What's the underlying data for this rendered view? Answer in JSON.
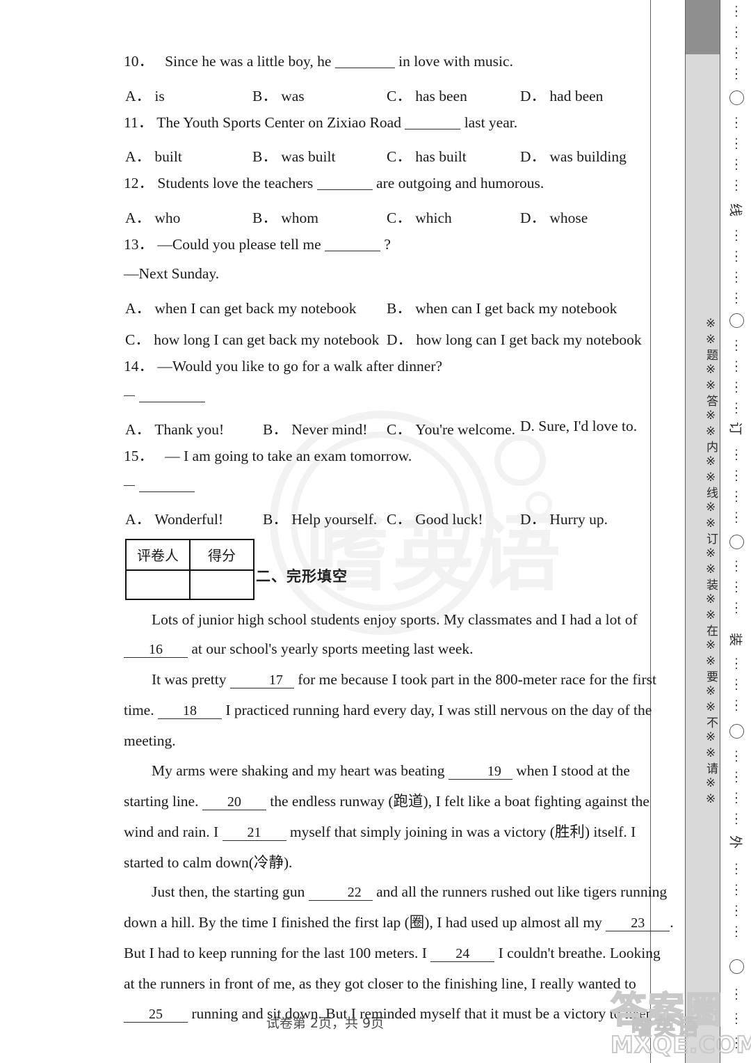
{
  "document": {
    "footer": "试卷第 2页，共 9页"
  },
  "questions": [
    {
      "number": "10．",
      "stem_before": "Since he was a little boy, he",
      "stem_after": "in love with music.",
      "options": [
        {
          "label": "A．",
          "text": "is"
        },
        {
          "label": "B．",
          "text": "was"
        },
        {
          "label": "C．",
          "text": "has been"
        },
        {
          "label": "D．",
          "text": "had been"
        }
      ]
    },
    {
      "number": "11．",
      "stem_before": "The Youth Sports Center on Zixiao Road",
      "stem_after": "last year.",
      "options": [
        {
          "label": "A．",
          "text": "built"
        },
        {
          "label": "B．",
          "text": "was built"
        },
        {
          "label": "C．",
          "text": "has built"
        },
        {
          "label": "D．",
          "text": "was building"
        }
      ]
    },
    {
      "number": "12．",
      "stem_before": "Students love the teachers",
      "stem_after": "are outgoing and humorous.",
      "options": [
        {
          "label": "A．",
          "text": "who"
        },
        {
          "label": "B．",
          "text": "whom"
        },
        {
          "label": "C．",
          "text": "which"
        },
        {
          "label": "D．",
          "text": "whose"
        }
      ]
    },
    {
      "number": "13．",
      "stem_before": "—Could you please tell me",
      "stem_after": "?",
      "reply": "—Next Sunday.",
      "options_wide": [
        {
          "label": "A．",
          "text": "when I can get back my notebook"
        },
        {
          "label": "B．",
          "text": "when can I get back my notebook"
        },
        {
          "label": "C．",
          "text": "how long I can get back my notebook"
        },
        {
          "label": "D．",
          "text": "how long can I get back my notebook"
        }
      ]
    },
    {
      "number": "14．",
      "stem": "—Would you like to go for a walk after dinner?",
      "options": [
        {
          "label": "A．",
          "text": "Thank you!"
        },
        {
          "label": "B．",
          "text": "Never mind!"
        },
        {
          "label": "C．",
          "text": "You're welcome."
        },
        {
          "label": "D.",
          "text": "Sure, I'd love to."
        }
      ]
    },
    {
      "number": "15．",
      "stem": "— I am going to take an exam tomorrow.",
      "options": [
        {
          "label": "A．",
          "text": "Wonderful!"
        },
        {
          "label": "B．",
          "text": "Help yourself."
        },
        {
          "label": "C．",
          "text": "Good luck!"
        },
        {
          "label": "D．",
          "text": "Hurry up."
        }
      ]
    }
  ],
  "score_table": {
    "grader_label": "评卷人",
    "score_label": "得分"
  },
  "section": {
    "title": "二、完形填空"
  },
  "passage": {
    "lines": [
      {
        "indent": true,
        "parts": [
          {
            "t": "text",
            "v": "Lots of junior high school students enjoy sports. My classmates and I had a lot of"
          }
        ]
      },
      {
        "indent": false,
        "parts": [
          {
            "t": "blank",
            "v": "16"
          },
          {
            "t": "text",
            "v": " at our school's yearly sports meeting last week."
          }
        ]
      },
      {
        "indent": true,
        "parts": [
          {
            "t": "text",
            "v": "It was pretty "
          },
          {
            "t": "blank",
            "v": "17"
          },
          {
            "t": "text",
            "v": " for me because I took part in the 800-meter race for the first"
          }
        ]
      },
      {
        "indent": false,
        "parts": [
          {
            "t": "text",
            "v": "time. "
          },
          {
            "t": "blank",
            "v": "18"
          },
          {
            "t": "text",
            "v": " I practiced running hard every day, I was still nervous on the day of the"
          }
        ]
      },
      {
        "indent": false,
        "parts": [
          {
            "t": "text",
            "v": "meeting."
          }
        ]
      },
      {
        "indent": true,
        "parts": [
          {
            "t": "text",
            "v": "My arms were shaking and my heart was beating "
          },
          {
            "t": "blank",
            "v": "19"
          },
          {
            "t": "text",
            "v": " when I stood at the"
          }
        ]
      },
      {
        "indent": false,
        "parts": [
          {
            "t": "text",
            "v": "starting line. "
          },
          {
            "t": "blank",
            "v": "20"
          },
          {
            "t": "text",
            "v": " the endless runway (跑道), I felt like a boat fighting against the"
          }
        ]
      },
      {
        "indent": false,
        "parts": [
          {
            "t": "text",
            "v": "wind and rain. I "
          },
          {
            "t": "blank",
            "v": "21"
          },
          {
            "t": "text",
            "v": " myself that simply joining in was a victory (胜利) itself. I"
          }
        ]
      },
      {
        "indent": false,
        "parts": [
          {
            "t": "text",
            "v": "started to calm down(冷静)."
          }
        ]
      },
      {
        "indent": true,
        "parts": [
          {
            "t": "text",
            "v": "Just then, the starting gun "
          },
          {
            "t": "blank",
            "v": "22"
          },
          {
            "t": "text",
            "v": " and all the runners rushed out like tigers running"
          }
        ]
      },
      {
        "indent": false,
        "parts": [
          {
            "t": "text",
            "v": "down a hill. By the time I finished the first lap (圈), I had used up almost all my "
          },
          {
            "t": "blank",
            "v": "23"
          },
          {
            "t": "text",
            "v": "."
          }
        ]
      },
      {
        "indent": false,
        "parts": [
          {
            "t": "text",
            "v": "But I had to keep running for the last 100 meters. I "
          },
          {
            "t": "blank",
            "v": "24"
          },
          {
            "t": "text",
            "v": " I couldn't breathe. Looking"
          }
        ]
      },
      {
        "indent": false,
        "parts": [
          {
            "t": "text",
            "v": "at the runners in front of me, as they got closer to the finishing line, I really wanted to"
          }
        ]
      },
      {
        "indent": false,
        "parts": [
          {
            "t": "blank",
            "v": "25"
          },
          {
            "t": "text",
            "v": " running and sit down. But I reminded myself that it must be a victory to keep"
          }
        ]
      }
    ]
  },
  "seal_margin": {
    "vertical_text": "※※题※※答※※内※※线※※订※※装※※在※※要※※不※※请※※",
    "markers": [
      "线",
      "订",
      "装",
      "外"
    ]
  },
  "watermarks": {
    "center_text": "嗜英语",
    "corner_cn": "答案圈",
    "corner_cn_small": "嗜英语",
    "corner_domain": "MXQE.COM"
  }
}
